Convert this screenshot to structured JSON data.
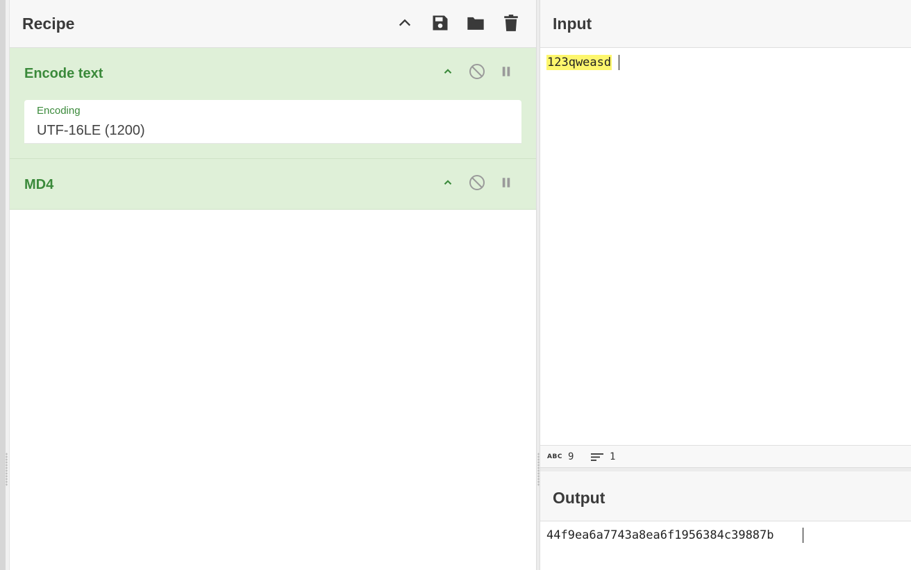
{
  "recipe": {
    "title": "Recipe",
    "operations": [
      {
        "name": "Encode text",
        "arg_label": "Encoding",
        "arg_value": "UTF-16LE (1200)"
      },
      {
        "name": "MD4"
      }
    ]
  },
  "input": {
    "title": "Input",
    "text": "123qweasd",
    "char_count": "9",
    "line_count": "1",
    "abc_label": "ABC"
  },
  "output": {
    "title": "Output",
    "text": "44f9ea6a7743a8ea6f1956384c39887b"
  },
  "colors": {
    "operation_bg": "#dff0d8",
    "operation_text": "#3b8a3b",
    "highlight": "#fdf66d"
  }
}
